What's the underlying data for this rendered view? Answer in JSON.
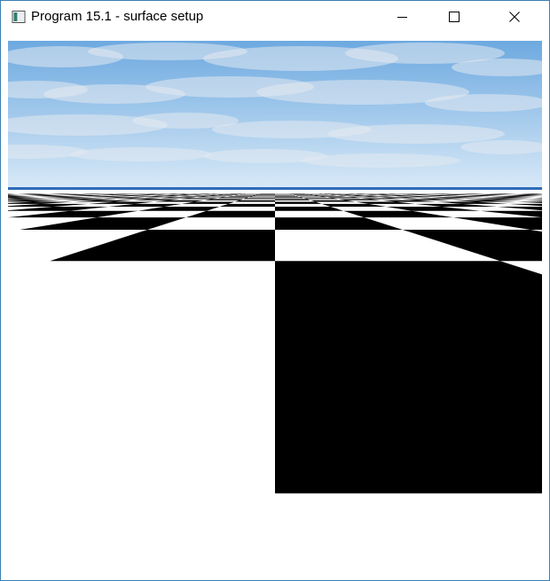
{
  "window": {
    "title": "Program 15.1 - surface setup",
    "controls": {
      "minimize_icon": "minimize-icon",
      "maximize_icon": "maximize-icon",
      "close_icon": "close-icon"
    }
  },
  "scene": {
    "floor_pattern": "checkerboard",
    "tile_colors": [
      "#000000",
      "#ffffff"
    ],
    "sky_colors": {
      "top": "#6da9e0",
      "horizon": "#d8e9f7",
      "cloud": "#e4eaf1"
    },
    "horizon_line_color": "#2f6cb8"
  }
}
